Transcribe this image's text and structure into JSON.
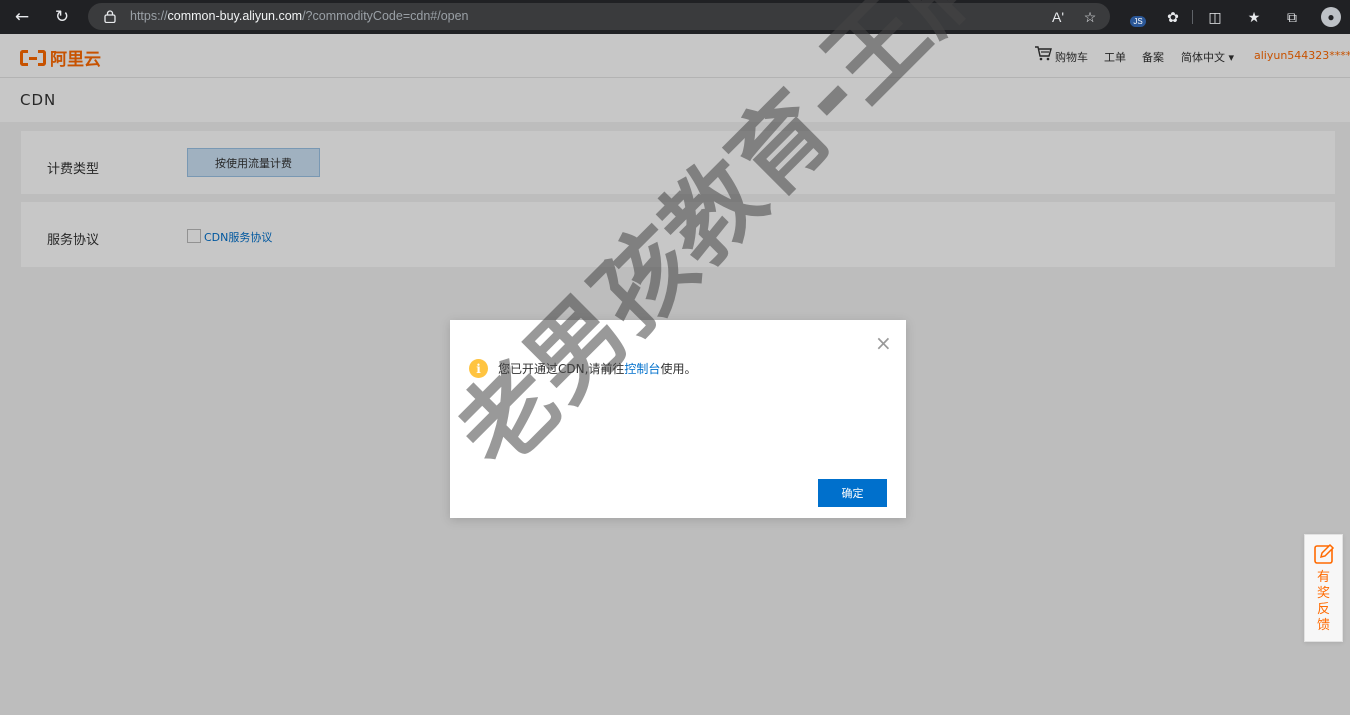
{
  "browser": {
    "url_scheme": "https://",
    "url_host": "common-buy.aliyun.com",
    "url_path": "/?commodityCode=cdn#/open",
    "icons": [
      "back-icon",
      "refresh-icon",
      "lock-icon",
      "read-aloud-icon",
      "favorite-add-icon",
      "js-extension-icon",
      "extensions-icon",
      "split-screen-icon",
      "favorites-icon",
      "collections-icon",
      "profile-icon"
    ],
    "read_aloud_text": "Aʹ",
    "js_badge": "JS"
  },
  "header": {
    "logo_text": "阿里云",
    "nav": {
      "cart": "购物车",
      "ticket": "工单",
      "filing": "备案",
      "language": "简体中文 ▾",
      "user": "aliyun544323****"
    }
  },
  "product": {
    "title": "CDN"
  },
  "form": {
    "billing_label": "计费类型",
    "billing_option": "按使用流量计费",
    "agreement_label": "服务协议",
    "agreement_link": "CDN服务协议"
  },
  "modal": {
    "message_before": "您已开通过CDN,请前往",
    "message_link": "控制台",
    "message_after": "使用。",
    "ok_label": "确定",
    "close_glyph": "×"
  },
  "feedback": {
    "label": "有奖反馈"
  },
  "watermark": "老男孩教育-王牌V",
  "colors": {
    "brand": "#ff6a00",
    "link": "#0070cc",
    "primary_button": "#0070cc",
    "warning": "#ffc440"
  }
}
